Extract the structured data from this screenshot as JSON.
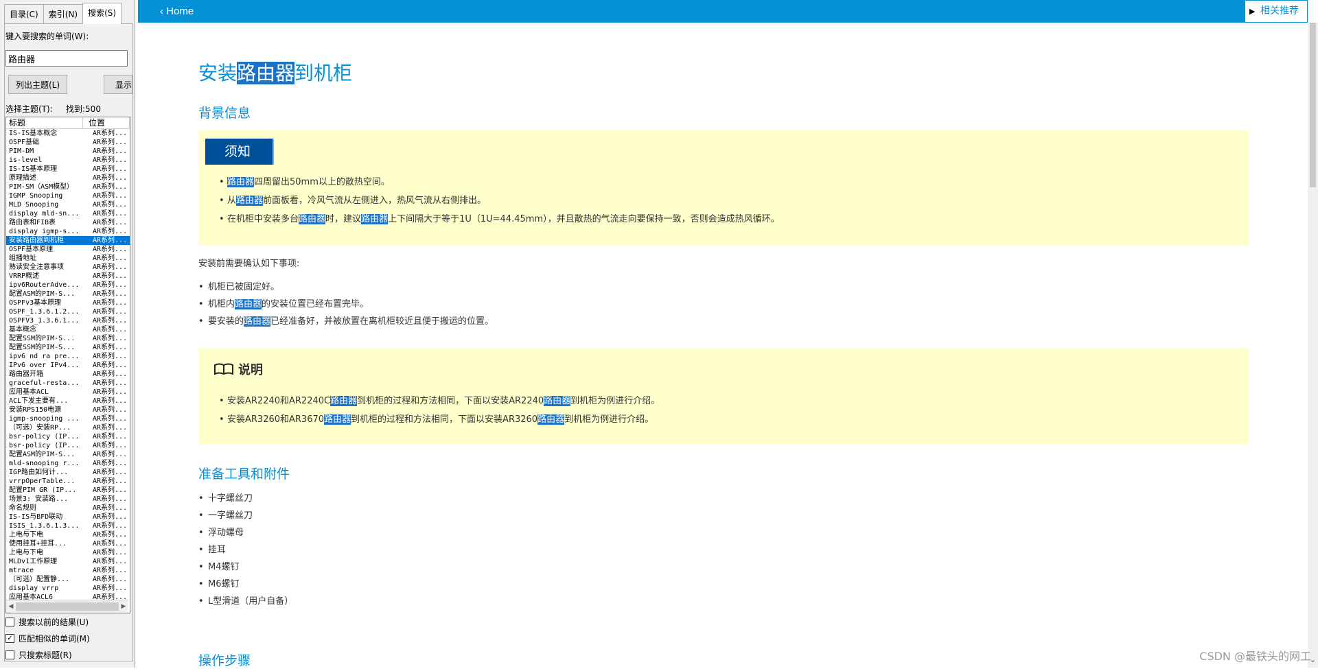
{
  "left_pane": {
    "tabs": [
      "目录(C)",
      "索引(N)",
      "搜索(S)"
    ],
    "search_label": "键入要搜索的单词(W):",
    "search_value": "路由器",
    "list_topics_button": "列出主题(L)",
    "display_button": "显示",
    "select_topic_label": "选择主题(T):",
    "found_label": "找到:500",
    "columns": [
      "标题",
      "位置"
    ],
    "rows": [
      [
        "IS-IS基本概念",
        "AR系列..."
      ],
      [
        "OSPF基础",
        "AR系列..."
      ],
      [
        "PIM-DM",
        "AR系列..."
      ],
      [
        "is-level",
        "AR系列..."
      ],
      [
        "IS-IS基本原理",
        "AR系列..."
      ],
      [
        "原理描述",
        "AR系列..."
      ],
      [
        "PIM-SM（ASM模型）",
        "AR系列..."
      ],
      [
        "IGMP Snooping",
        "AR系列..."
      ],
      [
        "MLD Snooping",
        "AR系列..."
      ],
      [
        "display mld-sn...",
        "AR系列..."
      ],
      [
        "路由表和FIB表",
        "AR系列..."
      ],
      [
        "display igmp-s...",
        "AR系列..."
      ],
      [
        "安装路由器到机柜",
        "AR系列..."
      ],
      [
        "OSPF基本原理",
        "AR系列..."
      ],
      [
        "组播地址",
        "AR系列..."
      ],
      [
        "熟读安全注意事项",
        "AR系列..."
      ],
      [
        "VRRP概述",
        "AR系列..."
      ],
      [
        "ipv6RouterAdve...",
        "AR系列..."
      ],
      [
        "配置ASM的PIM-S...",
        "AR系列..."
      ],
      [
        "OSPFv3基本原理",
        "AR系列..."
      ],
      [
        "OSPF_1.3.6.1.2...",
        "AR系列..."
      ],
      [
        "OSPFV3_1.3.6.1...",
        "AR系列..."
      ],
      [
        "基本概念",
        "AR系列..."
      ],
      [
        "配置SSM的PIM-S...",
        "AR系列..."
      ],
      [
        "配置SSM的PIM-S...",
        "AR系列..."
      ],
      [
        "ipv6 nd ra pre...",
        "AR系列..."
      ],
      [
        "IPv6 over IPv4...",
        "AR系列..."
      ],
      [
        "路由器开箱",
        "AR系列..."
      ],
      [
        "graceful-resta...",
        "AR系列..."
      ],
      [
        "应用基本ACL",
        "AR系列..."
      ],
      [
        "ACL下发主要有...",
        "AR系列..."
      ],
      [
        "安装RPS150电源",
        "AR系列..."
      ],
      [
        "igmp-snooping ...",
        "AR系列..."
      ],
      [
        "（可选）安装RP...",
        "AR系列..."
      ],
      [
        "bsr-policy (IP...",
        "AR系列..."
      ],
      [
        "bsr-policy (IP...",
        "AR系列..."
      ],
      [
        "配置ASM的PIM-S...",
        "AR系列..."
      ],
      [
        "mld-snooping r...",
        "AR系列..."
      ],
      [
        "IGP路由如何计...",
        "AR系列..."
      ],
      [
        "vrrpOperTable...",
        "AR系列..."
      ],
      [
        "配置PIM GR (IP...",
        "AR系列..."
      ],
      [
        "场景3: 安装路...",
        "AR系列..."
      ],
      [
        "命名规则",
        "AR系列..."
      ],
      [
        "IS-IS与BFD联动",
        "AR系列..."
      ],
      [
        "ISIS_1.3.6.1.3...",
        "AR系列..."
      ],
      [
        "上电与下电",
        "AR系列..."
      ],
      [
        "使用挂耳+挂耳...",
        "AR系列..."
      ],
      [
        "上电与下电",
        "AR系列..."
      ],
      [
        "MLDv1工作原理",
        "AR系列..."
      ],
      [
        "mtrace",
        "AR系列..."
      ],
      [
        "（可选）配置静...",
        "AR系列..."
      ],
      [
        "display vrrp",
        "AR系列..."
      ],
      [
        "应用基本ACL6",
        "AR系列..."
      ]
    ],
    "selected_row_index": 12,
    "checkboxes": [
      {
        "label": "搜索以前的结果(U)",
        "checked": false
      },
      {
        "label": "匹配相似的单词(M)",
        "checked": true
      },
      {
        "label": "只搜索标题(R)",
        "checked": false
      }
    ]
  },
  "topbar": {
    "home_label": "Home",
    "recommend_label": "相关推荐",
    "bar_color": "#0591d7"
  },
  "article": {
    "title": {
      "pre": "安装",
      "hl": "路由器",
      "post": "到机柜"
    },
    "section_background": "背景信息",
    "notice_label": "须知",
    "notice_items": [
      [
        {
          "t": "路由器",
          "hl": true
        },
        {
          "t": "四周留出50mm以上的散热空间。"
        }
      ],
      [
        {
          "t": "从"
        },
        {
          "t": "路由器",
          "hl": true
        },
        {
          "t": "前面板看，冷风气流从左侧进入，热风气流从右侧排出。"
        }
      ],
      [
        {
          "t": "在机柜中安装多台"
        },
        {
          "t": "路由器",
          "hl": true
        },
        {
          "t": "时，建议"
        },
        {
          "t": "路由器",
          "hl": true
        },
        {
          "t": "上下间隔大于等于1U（1U=44.45mm），并且散热的气流走向要保持一致，否则会造成热风循环。"
        }
      ]
    ],
    "precheck_intro": "安装前需要确认如下事项:",
    "precheck_items": [
      [
        {
          "t": "机柜已被固定好。"
        }
      ],
      [
        {
          "t": "机柜内"
        },
        {
          "t": "路由器",
          "hl": true
        },
        {
          "t": "的安装位置已经布置完毕。"
        }
      ],
      [
        {
          "t": "要安装的"
        },
        {
          "t": "路由器",
          "hl": true
        },
        {
          "t": "已经准备好，并被放置在离机柜较近且便于搬运的位置。"
        }
      ]
    ],
    "note_label": "说明",
    "note_items": [
      [
        {
          "t": "安装AR2240和AR2240C"
        },
        {
          "t": "路由器",
          "hl": true
        },
        {
          "t": "到机柜的过程和方法相同，下面以安装AR2240"
        },
        {
          "t": "路由器",
          "hl": true
        },
        {
          "t": "到机柜为例进行介绍。"
        }
      ],
      [
        {
          "t": "安装AR3260和AR3670"
        },
        {
          "t": "路由器",
          "hl": true
        },
        {
          "t": "到机柜的过程和方法相同，下面以安装AR3260"
        },
        {
          "t": "路由器",
          "hl": true
        },
        {
          "t": "到机柜为例进行介绍。"
        }
      ]
    ],
    "section_tools": "准备工具和附件",
    "tools": [
      "十字螺丝刀",
      "一字螺丝刀",
      "浮动螺母",
      "挂耳",
      "M4螺钉",
      "M6螺钉",
      "L型滑道（用户自备）"
    ],
    "section_steps": "操作步骤",
    "highlight_color": "#1c72c4",
    "panel_color": "#ffffcc"
  },
  "watermark": "CSDN @最铁头的网工"
}
